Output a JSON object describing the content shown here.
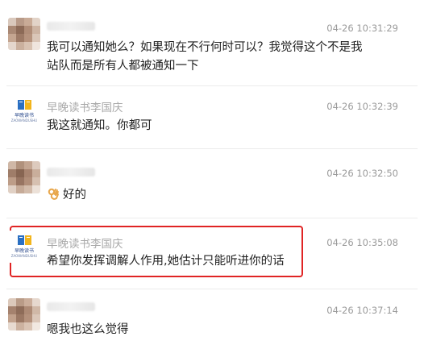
{
  "messages": [
    {
      "sender": "",
      "time": "04-26 10:31:29",
      "lines": [
        "我可以通知她么？如果现在不行何时可以？我觉得这个不是我",
        "站队而是所有人都被通知一下"
      ]
    },
    {
      "sender": "早晚读书李国庆",
      "time": "04-26 10:32:39",
      "lines": [
        "我这就通知。你都可"
      ]
    },
    {
      "sender": "",
      "time": "04-26 10:32:50",
      "emoji": "ok-hand-emoji",
      "lines": [
        "好的"
      ]
    },
    {
      "sender": "早晚读书李国庆",
      "time": "04-26 10:35:08",
      "lines": [
        "希望你发挥调解人作用,她估计只能听进你的话"
      ]
    },
    {
      "sender": "",
      "time": "04-26 10:37:14",
      "lines": [
        "嗯我也这么觉得"
      ]
    }
  ],
  "logo": {
    "text": "早晚读书",
    "sub": "ZAOWANDUSHU"
  },
  "colors": {
    "highlight_border": "#e02424",
    "timestamp": "#9a9a9a",
    "sender_name": "#a8a8a8",
    "message_text": "#222222"
  }
}
